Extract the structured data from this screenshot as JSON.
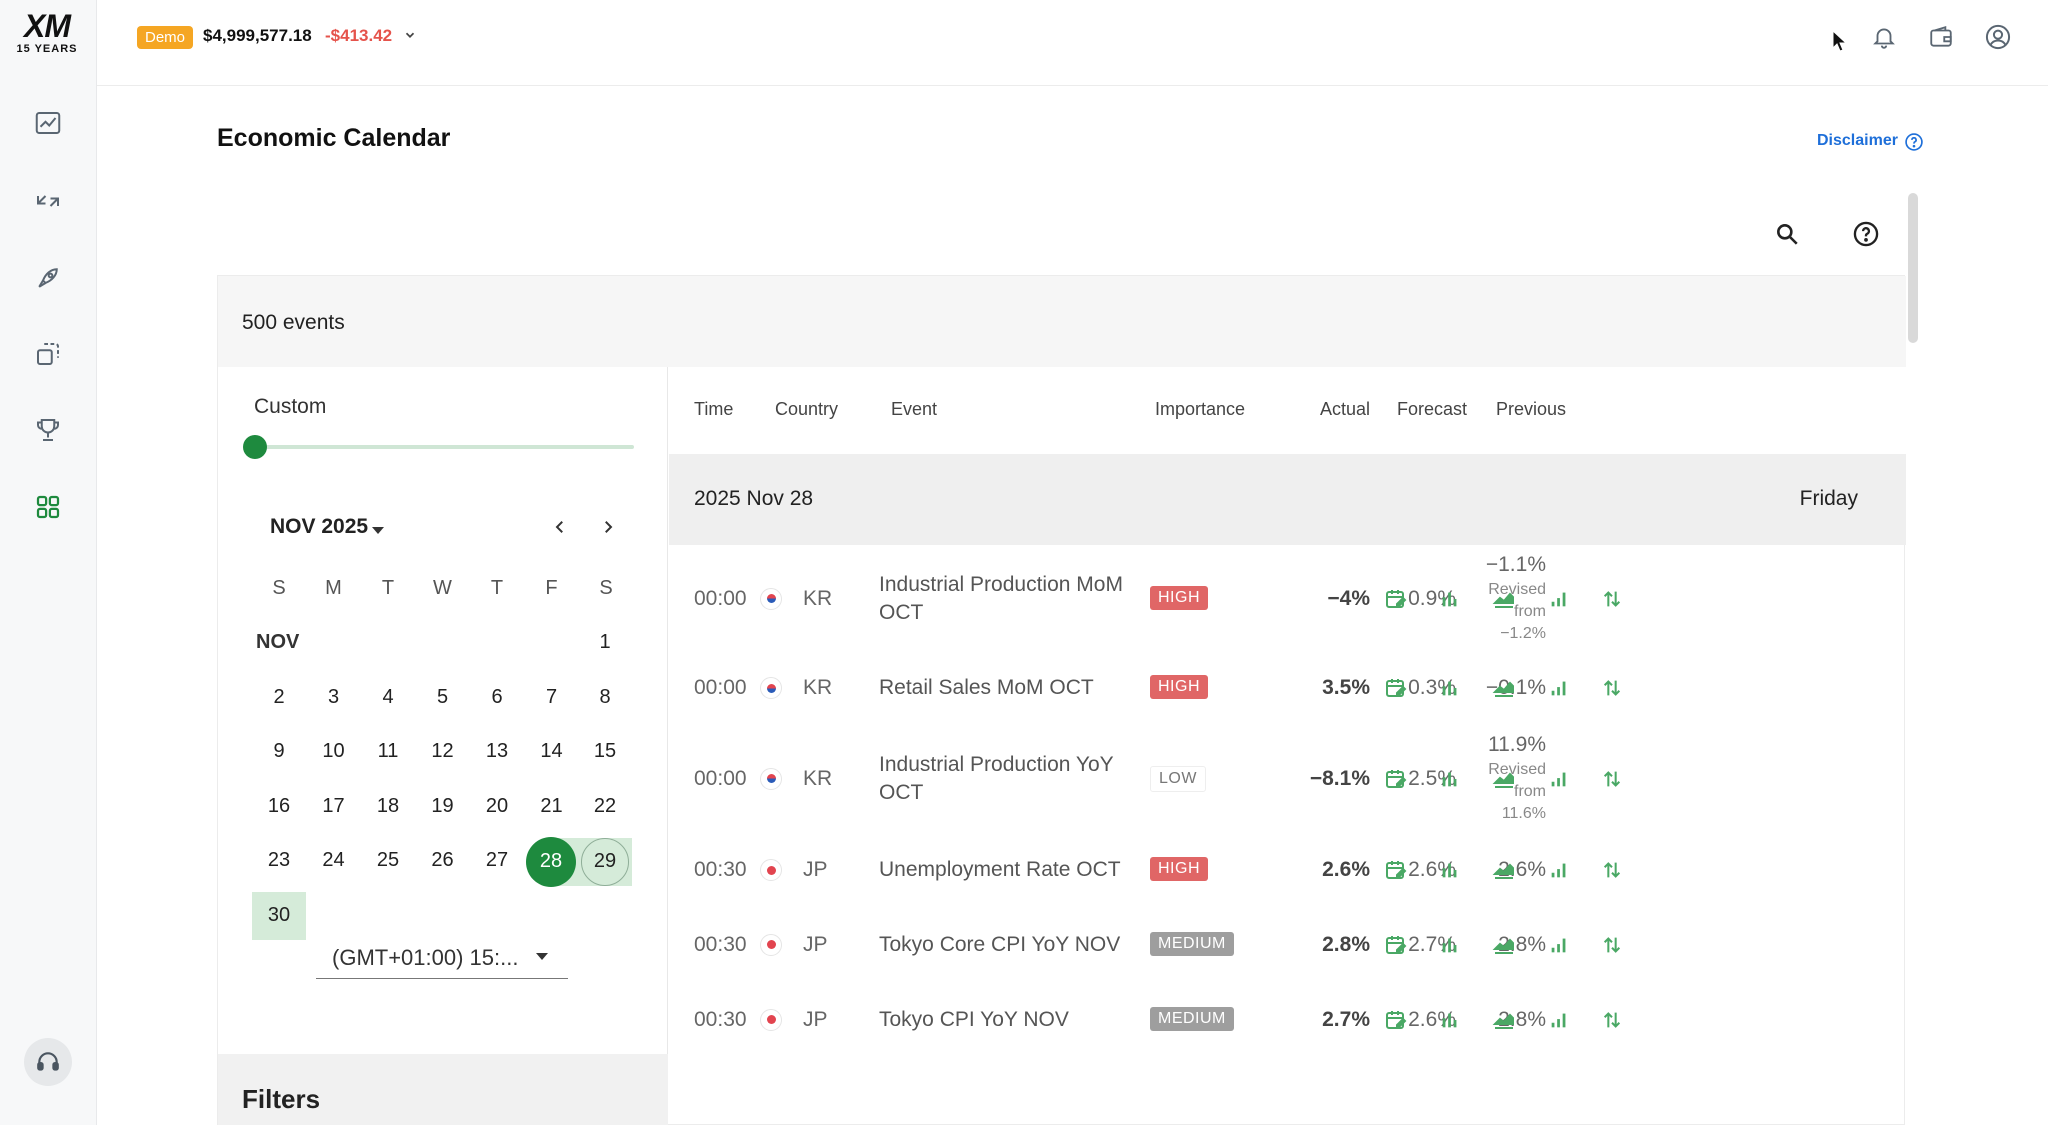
{
  "brand": {
    "logo_text": "XM",
    "logo_sub": "15 YEARS"
  },
  "sidebar": {
    "items": [
      {
        "name": "chart-icon"
      },
      {
        "name": "trade-arrows-icon"
      },
      {
        "name": "rocket-icon"
      },
      {
        "name": "copy-icon"
      },
      {
        "name": "trophy-icon"
      },
      {
        "name": "apps-grid-icon",
        "active": true
      }
    ],
    "support_icon": "headset-icon"
  },
  "topbar": {
    "badge": "Demo",
    "balance": "$4,999,577.18",
    "pnl": "-$413.42",
    "icons": [
      "bell-icon",
      "wallet-icon",
      "user-icon"
    ]
  },
  "page": {
    "title": "Economic Calendar",
    "disclaimer": "Disclaimer"
  },
  "widget": {
    "events_count": "500 events",
    "custom_label": "Custom",
    "month": "NOV 2025",
    "weekdays": [
      "S",
      "M",
      "T",
      "W",
      "T",
      "F",
      "S"
    ],
    "nov_label": "NOV",
    "timezone": "(GMT+01:00) 15:...",
    "filters_label": "Filters"
  },
  "table": {
    "headers": {
      "time": "Time",
      "country": "Country",
      "event": "Event",
      "importance": "Importance",
      "actual": "Actual",
      "forecast": "Forecast",
      "previous": "Previous"
    },
    "date": "2025 Nov 28",
    "weekday": "Friday",
    "rows": [
      {
        "time": "00:00",
        "country": "KR",
        "event": "Industrial Production MoM OCT",
        "importance": "HIGH",
        "actual": "−4%",
        "forecast": "0.9%",
        "previous": "−1.1%",
        "revised": "Revised from −1.2%"
      },
      {
        "time": "00:00",
        "country": "KR",
        "event": "Retail Sales MoM OCT",
        "importance": "HIGH",
        "actual": "3.5%",
        "forecast": "0.3%",
        "previous": "−0.1%",
        "revised": ""
      },
      {
        "time": "00:00",
        "country": "KR",
        "event": "Industrial Production YoY OCT",
        "importance": "LOW",
        "actual": "−8.1%",
        "forecast": "2.5%",
        "previous": "11.9%",
        "revised": "Revised from 11.6%"
      },
      {
        "time": "00:30",
        "country": "JP",
        "event": "Unemployment Rate OCT",
        "importance": "HIGH",
        "actual": "2.6%",
        "forecast": "2.6%",
        "previous": "2.6%",
        "revised": ""
      },
      {
        "time": "00:30",
        "country": "JP",
        "event": "Tokyo Core CPI YoY NOV",
        "importance": "MEDIUM",
        "actual": "2.8%",
        "forecast": "2.7%",
        "previous": "2.8%",
        "revised": ""
      },
      {
        "time": "00:30",
        "country": "JP",
        "event": "Tokyo CPI YoY NOV",
        "importance": "MEDIUM",
        "actual": "2.7%",
        "forecast": "2.6%",
        "previous": "2.8%",
        "revised": ""
      }
    ],
    "row_actions": [
      "calendar-edit-icon",
      "bar-chart-icon",
      "area-chart-icon",
      "signal-bars-icon",
      "swap-vertical-icon"
    ]
  },
  "colors": {
    "accent": "#1e8a3e",
    "high": "#e06666",
    "medium": "#9e9e9e",
    "demo": "#f5a623",
    "negative": "#e5534b",
    "link": "#1e6fd9"
  }
}
